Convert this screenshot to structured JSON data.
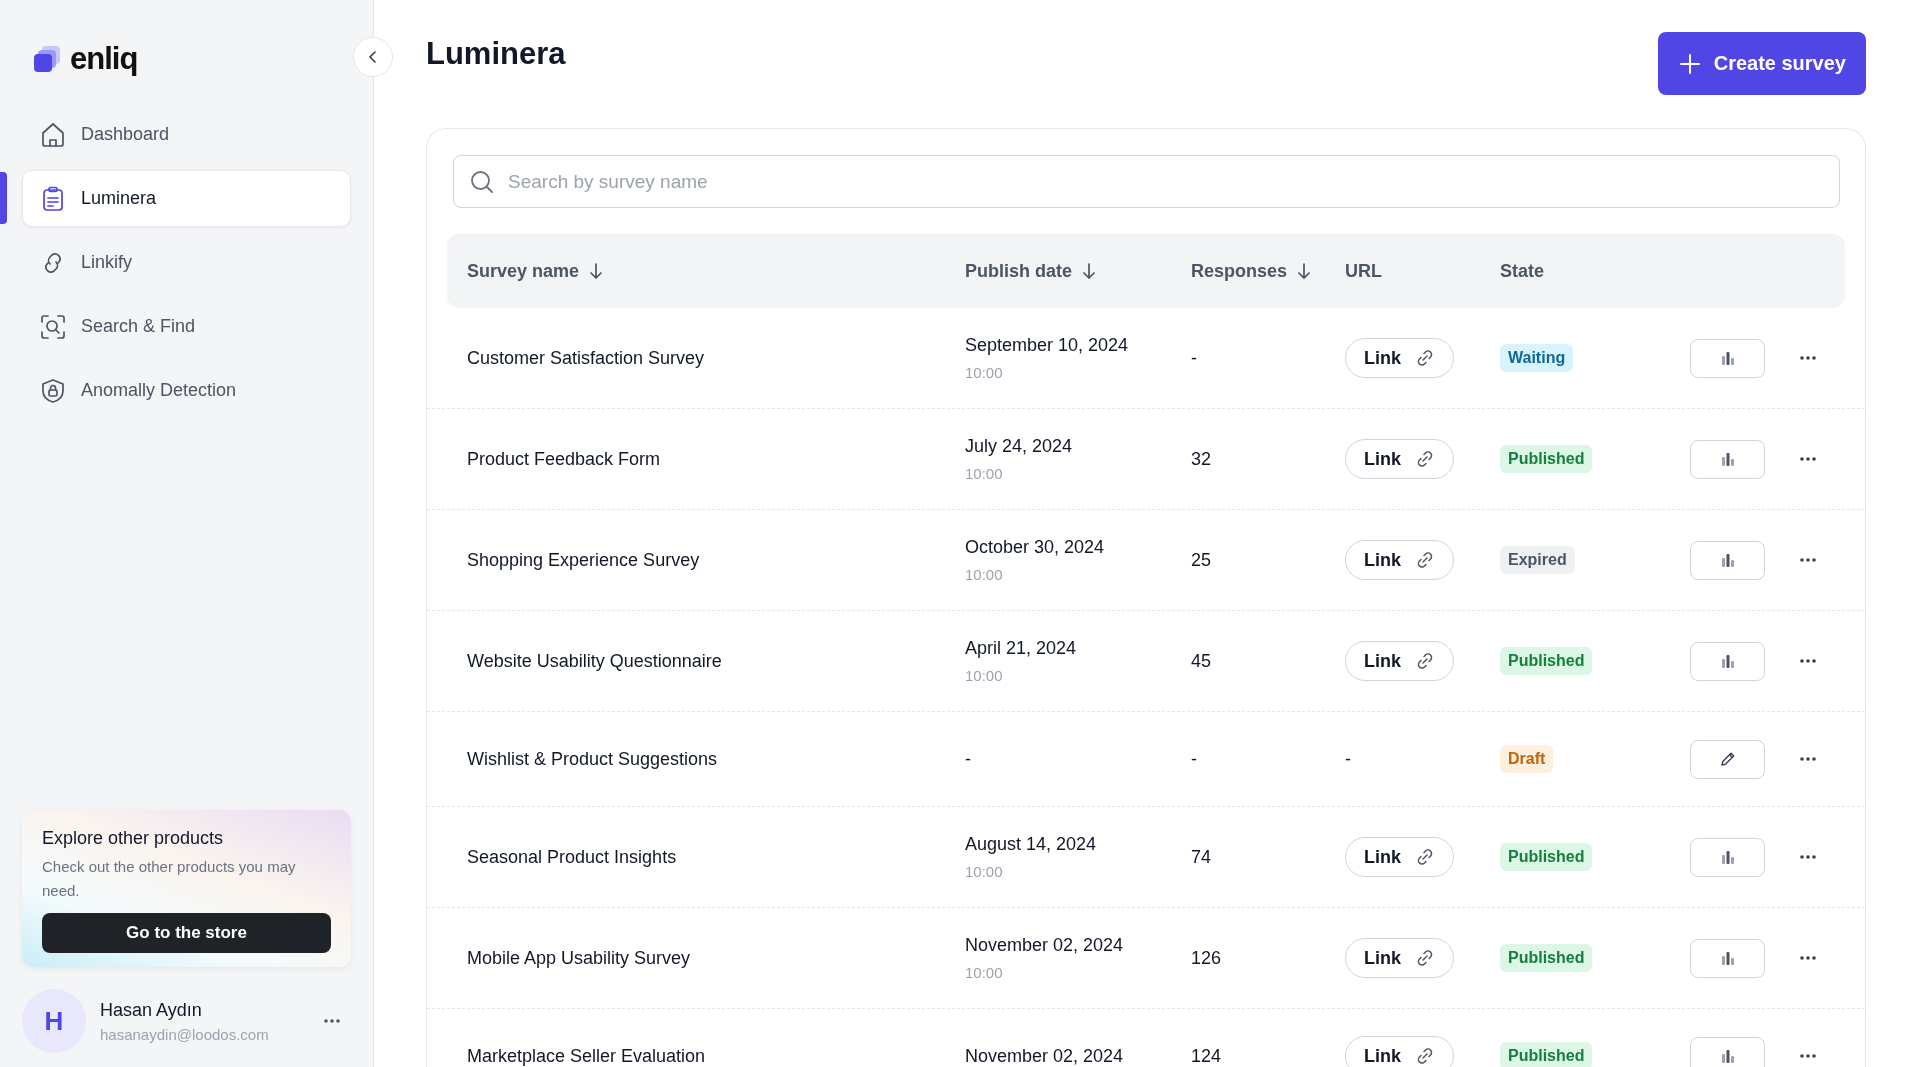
{
  "sidebar": {
    "logo": "enliq",
    "items": [
      {
        "label": "Dashboard",
        "selected": false
      },
      {
        "label": "Luminera",
        "selected": true
      },
      {
        "label": "Linkify",
        "selected": false
      },
      {
        "label": "Search & Find",
        "selected": false
      },
      {
        "label": "Anomally Detection",
        "selected": false
      }
    ],
    "promo": {
      "title": "Explore other products",
      "text": "Check out the other products you may need.",
      "button": "Go to the store"
    },
    "user": {
      "initial": "H",
      "name": "Hasan Aydın",
      "email": "hasanaydin@loodos.com"
    }
  },
  "page": {
    "title": "Luminera",
    "create_button": "Create survey"
  },
  "search": {
    "placeholder": "Search by survey name"
  },
  "table": {
    "columns": [
      {
        "label": "Survey name",
        "sortable": true
      },
      {
        "label": "Publish date",
        "sortable": true
      },
      {
        "label": "Responses",
        "sortable": true
      },
      {
        "label": "URL",
        "sortable": false
      },
      {
        "label": "State",
        "sortable": false
      }
    ],
    "rows": [
      {
        "name": "Customer Satisfaction Survey",
        "date": "September 10, 2024",
        "time": "10:00",
        "responses": "-",
        "url": {
          "text": "Link",
          "kind": "link"
        },
        "state": {
          "label": "Waiting",
          "kind": "info"
        },
        "action": {
          "kind": "stats"
        }
      },
      {
        "name": "Product Feedback Form",
        "date": "July 24, 2024",
        "time": "10:00",
        "responses": "32",
        "url": {
          "text": "Link",
          "kind": "link"
        },
        "state": {
          "label": "Published",
          "kind": "success"
        },
        "action": {
          "kind": "stats"
        }
      },
      {
        "name": "Shopping Experience Survey",
        "date": "October 30, 2024",
        "time": "10:00",
        "responses": "25",
        "url": {
          "text": "Link",
          "kind": "link"
        },
        "state": {
          "label": "Expired",
          "kind": "neutral"
        },
        "action": {
          "kind": "stats"
        }
      },
      {
        "name": "Website Usability Questionnaire",
        "date": "April 21, 2024",
        "time": "10:00",
        "responses": "45",
        "url": {
          "text": "Link",
          "kind": "link"
        },
        "state": {
          "label": "Published",
          "kind": "success"
        },
        "action": {
          "kind": "stats"
        }
      },
      {
        "name": "Wishlist & Product Suggestions",
        "date": "-",
        "responses": "-",
        "url": {
          "text": "-",
          "kind": "plain"
        },
        "state": {
          "label": "Draft",
          "kind": "warning"
        },
        "action": {
          "kind": "edit"
        }
      },
      {
        "name": "Seasonal Product Insights",
        "date": "August 14, 2024",
        "time": "10:00",
        "responses": "74",
        "url": {
          "text": "Link",
          "kind": "link"
        },
        "state": {
          "label": "Published",
          "kind": "success"
        },
        "action": {
          "kind": "stats"
        }
      },
      {
        "name": "Mobile App Usability Survey",
        "date": "November 02, 2024",
        "time": "10:00",
        "responses": "126",
        "url": {
          "text": "Link",
          "kind": "link"
        },
        "state": {
          "label": "Published",
          "kind": "success"
        },
        "action": {
          "kind": "stats"
        }
      },
      {
        "name": "Marketplace Seller Evaluation",
        "date": "November 02, 2024",
        "responses": "124",
        "url": {
          "text": "Link",
          "kind": "link"
        },
        "state": {
          "label": "Published",
          "kind": "success"
        },
        "action": {
          "kind": "stats"
        }
      }
    ]
  }
}
